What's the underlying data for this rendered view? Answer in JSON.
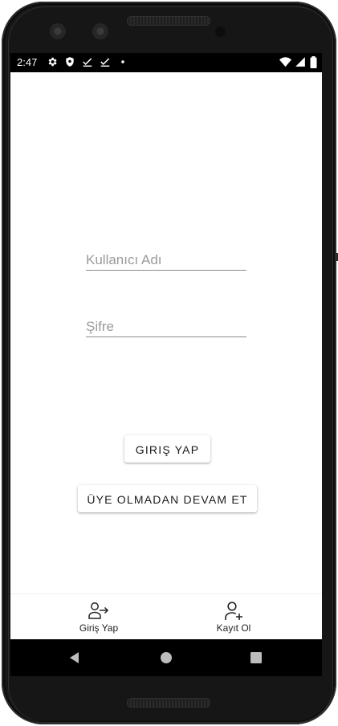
{
  "status_bar": {
    "time": "2:47",
    "icons_left": [
      "gear-icon",
      "shield-icon",
      "check-icon",
      "check-icon",
      "dot-icon"
    ],
    "icons_right": [
      "wifi-icon",
      "signal-icon",
      "battery-icon"
    ]
  },
  "login_form": {
    "username_placeholder": "Kullanıcı Adı",
    "username_value": "",
    "password_placeholder": "Şifre",
    "password_value": ""
  },
  "buttons": {
    "login_label": "GIRIŞ YAP",
    "guest_label": "ÜYE OLMADAN DEVAM ET"
  },
  "bottom_nav": {
    "items": [
      {
        "label": "Giriş Yap",
        "icon": "login-icon"
      },
      {
        "label": "Kayıt Ol",
        "icon": "add-user-icon"
      }
    ]
  },
  "system_nav": {
    "buttons": [
      "back-icon",
      "home-icon",
      "recents-icon"
    ]
  },
  "colors": {
    "screen_bg": "#ffffff",
    "status_bar_bg": "#000000",
    "device_frame": "#161616",
    "underline": "#8a8a8a",
    "placeholder": "#9a9a9a"
  }
}
